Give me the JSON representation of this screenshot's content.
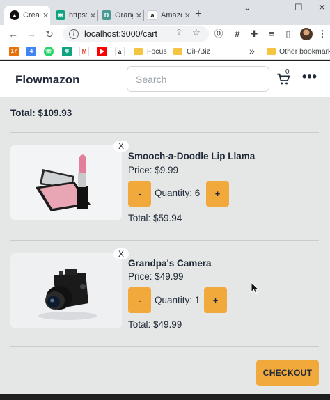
{
  "browser": {
    "tabs": [
      {
        "title": "Create",
        "favicon": "triangle-logo-icon",
        "active": true
      },
      {
        "title": "https://",
        "favicon": "openai-icon"
      },
      {
        "title": "Orange",
        "favicon": "d-logo-icon"
      },
      {
        "title": "Amazon",
        "favicon": "amazon-icon"
      }
    ],
    "url": "localhost:3000/cart",
    "bookmarks": {
      "folder1": "Focus",
      "folder2": "CiF/Biz",
      "overflow": "»",
      "other": "Other bookmarks"
    }
  },
  "app": {
    "brand": "Flowmazon",
    "search_placeholder": "Search",
    "cart_count": "0",
    "total_label": "Total: $109.93",
    "items": [
      {
        "name": "Smooch-a-Doodle Lip Llama",
        "price": "Price: $9.99",
        "minus": "-",
        "quantity": "Quantity: 6",
        "plus": "+",
        "total": "Total: $59.94",
        "remove": "X",
        "image": "lipstick-compact-image"
      },
      {
        "name": "Grandpa's Camera",
        "price": "Price: $49.99",
        "minus": "-",
        "quantity": "Quantity: 1",
        "plus": "+",
        "total": "Total: $49.99",
        "remove": "X",
        "image": "camera-image"
      }
    ],
    "checkout_label": "CHECKOUT"
  },
  "colors": {
    "accent": "#f2a93b",
    "page_bg": "#e5e6e6",
    "text": "#1f2937"
  }
}
